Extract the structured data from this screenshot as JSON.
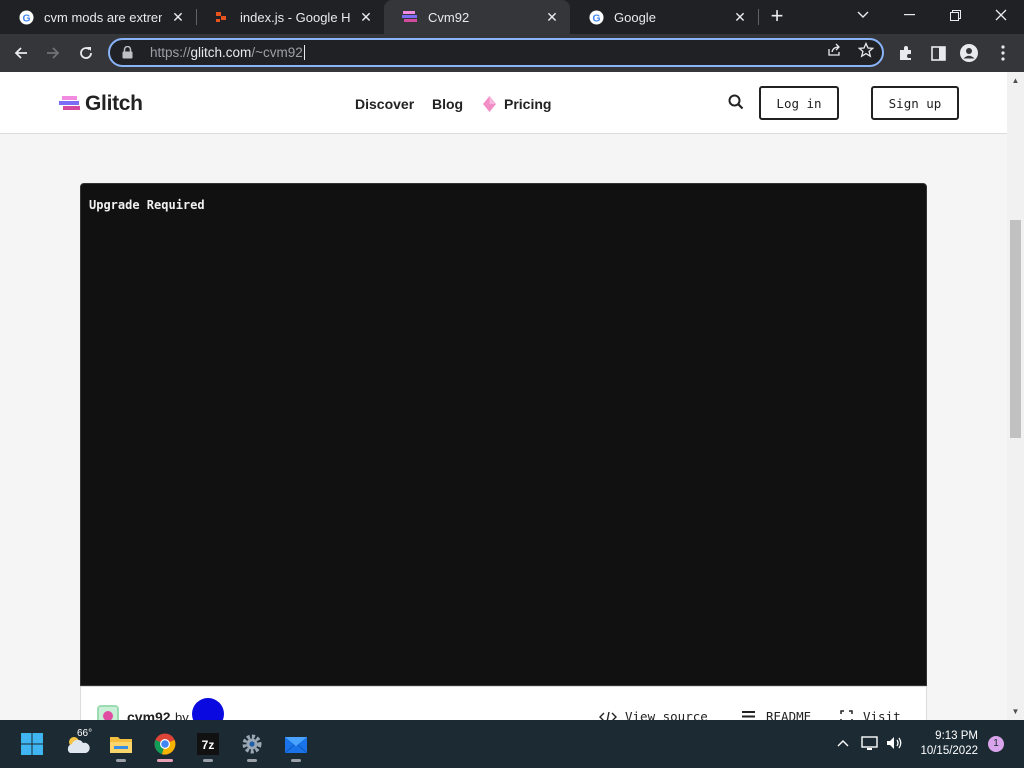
{
  "browser": {
    "tabs": [
      {
        "title": "cvm mods are extremel",
        "favicon": "google-icon",
        "active": false
      },
      {
        "title": "index.js - Google Hacki",
        "favicon": "glitch-editor-icon",
        "active": false
      },
      {
        "title": "Cvm92",
        "favicon": "glitch-icon",
        "active": true
      },
      {
        "title": "Google",
        "favicon": "google-icon",
        "active": false
      }
    ],
    "url_prefix": "https://",
    "url_domain": "glitch.com",
    "url_path": "/~cvm92"
  },
  "site": {
    "logo_text": "Glitch",
    "nav": {
      "discover": "Discover",
      "blog": "Blog",
      "pricing": "Pricing"
    },
    "login_label": "Log in",
    "signup_label": "Sign up"
  },
  "embed": {
    "message": "Upgrade Required"
  },
  "project": {
    "name": "cvm92",
    "by": "by",
    "view_source": "View source",
    "readme": "README",
    "visit": "Visit"
  },
  "taskbar": {
    "weather_temp": "66°",
    "time": "9:13 PM",
    "date": "10/15/2022",
    "notifications": "1"
  },
  "colors": {
    "accent": "#8ab4f8",
    "embed_bg": "#111111",
    "pricing_gem": "#f08ec5"
  }
}
